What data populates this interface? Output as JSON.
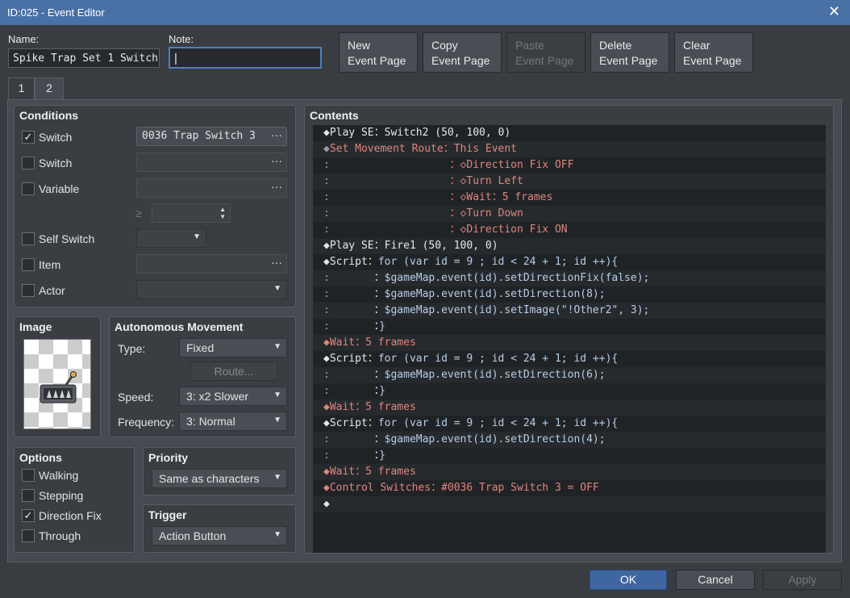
{
  "window": {
    "title": "ID:025 - Event Editor",
    "close_glyph": "✕"
  },
  "name": {
    "label": "Name:",
    "value": "Spike Trap Set 1 Switch"
  },
  "note": {
    "label": "Note:",
    "value": "|"
  },
  "toolbar": {
    "new_l1": "New",
    "new_l2": "Event Page",
    "copy_l1": "Copy",
    "copy_l2": "Event Page",
    "paste_l1": "Paste",
    "paste_l2": "Event Page",
    "delete_l1": "Delete",
    "delete_l2": "Event Page",
    "clear_l1": "Clear",
    "clear_l2": "Event Page"
  },
  "tabs": [
    "1",
    "2"
  ],
  "conditions": {
    "title": "Conditions",
    "switch1": {
      "label": "Switch",
      "checked": "✓",
      "value": "0036 Trap Switch 3"
    },
    "switch2": {
      "label": "Switch"
    },
    "variable": {
      "label": "Variable"
    },
    "gte": "≥",
    "self_switch": {
      "label": "Self Switch"
    },
    "item": {
      "label": "Item"
    },
    "actor": {
      "label": "Actor"
    }
  },
  "image": {
    "title": "Image"
  },
  "autonomous": {
    "title": "Autonomous Movement",
    "type_label": "Type:",
    "type_value": "Fixed",
    "route_label": "Route...",
    "speed_label": "Speed:",
    "speed_value": "3: x2 Slower",
    "freq_label": "Frequency:",
    "freq_value": "3: Normal"
  },
  "options": {
    "title": "Options",
    "walking": "Walking",
    "stepping": "Stepping",
    "direction_fix": "Direction Fix",
    "through": "Through",
    "checked": "✓"
  },
  "priority": {
    "title": "Priority",
    "value": "Same as characters"
  },
  "trigger": {
    "title": "Trigger",
    "value": "Action Button"
  },
  "contents": {
    "title": "Contents",
    "rows": [
      [
        [
          "w",
          "◆Play SE"
        ],
        [
          "w",
          "："
        ],
        [
          "w",
          "Switch2 (50, 100, 0)"
        ]
      ],
      [
        [
          "g",
          "◆"
        ],
        [
          "r",
          "Set Movement Route"
        ],
        [
          "r",
          "："
        ],
        [
          "r",
          "This Event"
        ]
      ],
      [
        [
          "g",
          ":"
        ],
        [
          "g",
          "                   "
        ],
        [
          "r",
          "："
        ],
        [
          "r",
          "◇Direction Fix OFF"
        ]
      ],
      [
        [
          "g",
          ":"
        ],
        [
          "g",
          "                   "
        ],
        [
          "r",
          "："
        ],
        [
          "r",
          "◇Turn Left"
        ]
      ],
      [
        [
          "g",
          ":"
        ],
        [
          "g",
          "                   "
        ],
        [
          "r",
          "："
        ],
        [
          "r",
          "◇Wait"
        ],
        [
          "r",
          "："
        ],
        [
          "r",
          "5 frames"
        ]
      ],
      [
        [
          "g",
          ":"
        ],
        [
          "g",
          "                   "
        ],
        [
          "r",
          "："
        ],
        [
          "r",
          "◇Turn Down"
        ]
      ],
      [
        [
          "g",
          ":"
        ],
        [
          "g",
          "                   "
        ],
        [
          "r",
          "："
        ],
        [
          "r",
          "◇Direction Fix ON"
        ]
      ],
      [
        [
          "w",
          "◆Play SE"
        ],
        [
          "w",
          "："
        ],
        [
          "w",
          "Fire1 (50, 100, 0)"
        ]
      ],
      [
        [
          "w",
          "◆Script"
        ],
        [
          "w",
          "："
        ],
        [
          "b",
          "for (var id = 9 ; id < 24 + 1; id ++){"
        ]
      ],
      [
        [
          "g",
          ":"
        ],
        [
          "g",
          "       "
        ],
        [
          "w",
          "："
        ],
        [
          "b",
          "$gameMap.event(id).setDirectionFix(false);"
        ]
      ],
      [
        [
          "g",
          ":"
        ],
        [
          "g",
          "       "
        ],
        [
          "w",
          "："
        ],
        [
          "b",
          "$gameMap.event(id).setDirection(8);"
        ]
      ],
      [
        [
          "g",
          ":"
        ],
        [
          "g",
          "       "
        ],
        [
          "w",
          "："
        ],
        [
          "b",
          "$gameMap.event(id).setImage(\"!Other2\", 3);"
        ]
      ],
      [
        [
          "g",
          ":"
        ],
        [
          "g",
          "       "
        ],
        [
          "w",
          "："
        ],
        [
          "b",
          "}"
        ]
      ],
      [
        [
          "r",
          "◆Wait"
        ],
        [
          "r",
          "："
        ],
        [
          "r",
          "5 frames"
        ]
      ],
      [
        [
          "w",
          "◆Script"
        ],
        [
          "w",
          "："
        ],
        [
          "b",
          "for (var id = 9 ; id < 24 + 1; id ++){"
        ]
      ],
      [
        [
          "g",
          ":"
        ],
        [
          "g",
          "       "
        ],
        [
          "w",
          "："
        ],
        [
          "b",
          "$gameMap.event(id).setDirection(6);"
        ]
      ],
      [
        [
          "g",
          ":"
        ],
        [
          "g",
          "       "
        ],
        [
          "w",
          "："
        ],
        [
          "b",
          "}"
        ]
      ],
      [
        [
          "r",
          "◆Wait"
        ],
        [
          "r",
          "："
        ],
        [
          "r",
          "5 frames"
        ]
      ],
      [
        [
          "w",
          "◆Script"
        ],
        [
          "w",
          "："
        ],
        [
          "b",
          "for (var id = 9 ; id < 24 + 1; id ++){"
        ]
      ],
      [
        [
          "g",
          ":"
        ],
        [
          "g",
          "       "
        ],
        [
          "w",
          "："
        ],
        [
          "b",
          "$gameMap.event(id).setDirection(4);"
        ]
      ],
      [
        [
          "g",
          ":"
        ],
        [
          "g",
          "       "
        ],
        [
          "w",
          "："
        ],
        [
          "b",
          "}"
        ]
      ],
      [
        [
          "r",
          "◆Wait"
        ],
        [
          "r",
          "："
        ],
        [
          "r",
          "5 frames"
        ]
      ],
      [
        [
          "r",
          "◆Control Switches"
        ],
        [
          "r",
          "："
        ],
        [
          "r",
          "#0036 Trap Switch 3 = OFF"
        ]
      ],
      [
        [
          "w",
          "◆"
        ]
      ]
    ]
  },
  "dialog": {
    "ok": "OK",
    "cancel": "Cancel",
    "apply": "Apply"
  },
  "colors": {
    "accent": "#4a71a6",
    "text_red": "#e0857d",
    "text_blue": "#b6cde8"
  }
}
